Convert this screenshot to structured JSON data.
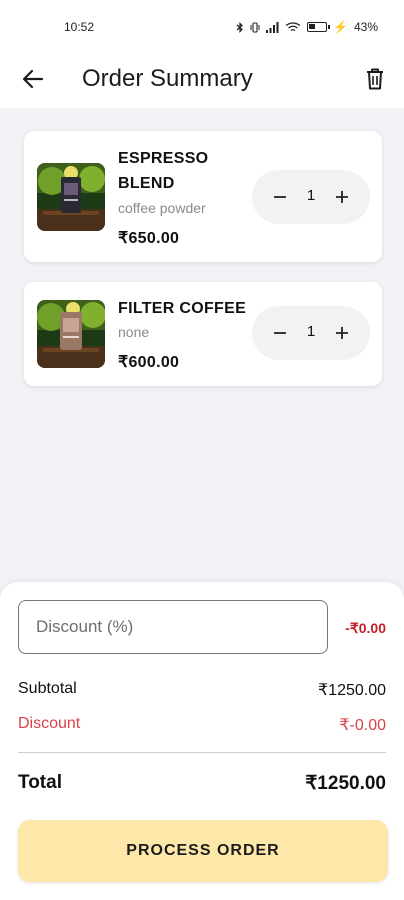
{
  "status_bar": {
    "time": "10:52",
    "battery": "43%",
    "battery_level": 0.43
  },
  "header": {
    "title": "Order Summary",
    "back_icon": "arrow-left-icon",
    "delete_icon": "trash-icon"
  },
  "items": [
    {
      "name_line1": "ESPRESSO",
      "name_line2": "BLEND",
      "subtitle": "coffee powder",
      "price": "₹650.00",
      "qty": "1"
    },
    {
      "name_line1": "FILTER COFFEE",
      "subtitle": "none",
      "price": "₹600.00",
      "qty": "1"
    }
  ],
  "summary": {
    "discount_placeholder": "Discount (%)",
    "discount_value": "",
    "discount_amount": "-₹0.00",
    "subtotal_label": "Subtotal",
    "subtotal_value": "₹1250.00",
    "discount_label": "Discount",
    "discount_row_value": "₹-0.00",
    "total_label": "Total",
    "total_value": "₹1250.00"
  },
  "actions": {
    "process_label": "PROCESS ORDER"
  },
  "colors": {
    "accent_button": "#fde8aa",
    "discount_red": "#d9434a",
    "background": "#f1f2f6"
  }
}
